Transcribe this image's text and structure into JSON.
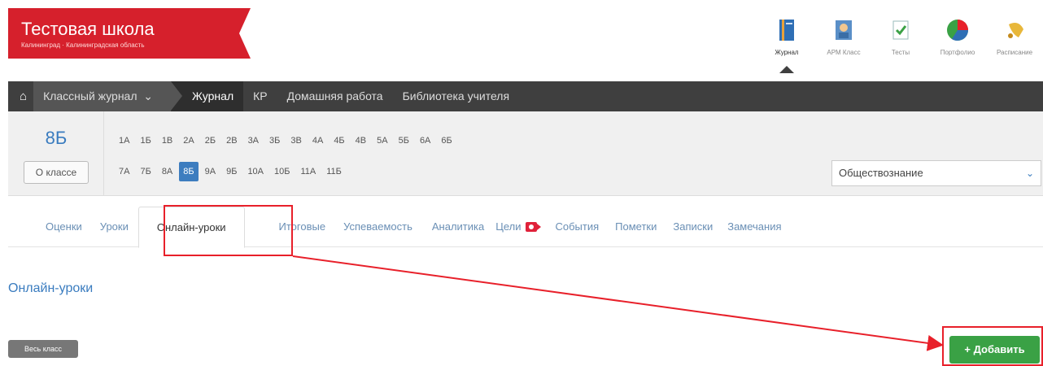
{
  "header": {
    "school_name": "Тестовая школа",
    "school_region": "Калининград · Калининградская область",
    "brand_color": "#d6202c",
    "apps": [
      {
        "label": "Журнал",
        "icon": "journal-book-icon",
        "active": true
      },
      {
        "label": "АРМ Класс",
        "icon": "class-workstation-icon",
        "active": false
      },
      {
        "label": "Тесты",
        "icon": "tests-checklist-icon",
        "active": false
      },
      {
        "label": "Портфолио",
        "icon": "portfolio-pie-icon",
        "active": false
      },
      {
        "label": "Расписание",
        "icon": "schedule-bell-icon",
        "active": false
      }
    ]
  },
  "nav": {
    "home_icon": "home-icon",
    "items": [
      "Классный журнал",
      "Журнал",
      "КР",
      "Домашняя работа",
      "Библиотека учителя"
    ],
    "active": "Журнал"
  },
  "class_panel": {
    "current_class": "8Б",
    "about_button": "О классе",
    "row1": [
      "1А",
      "1Б",
      "1В",
      "2А",
      "2Б",
      "2В",
      "3А",
      "3Б",
      "3В",
      "4А",
      "4Б",
      "4В",
      "5А",
      "5Б",
      "6А",
      "6Б"
    ],
    "row2": [
      "7А",
      "7Б",
      "8А",
      "8Б",
      "9А",
      "9Б",
      "10А",
      "10Б",
      "11А",
      "11Б"
    ],
    "selected": "8Б",
    "subject": "Обществознание"
  },
  "tabs": {
    "items": [
      "Оценки",
      "Уроки",
      "Онлайн-уроки",
      "Итоговые",
      "Успеваемость",
      "Аналитика",
      "Цели",
      "События",
      "Пометки",
      "Записки",
      "Замечания"
    ],
    "active": "Онлайн-уроки"
  },
  "main": {
    "section_title": "Онлайн-уроки",
    "all_class_button": "Весь класс",
    "add_button": "+ Добавить"
  },
  "annotation_color": "#e8202a"
}
